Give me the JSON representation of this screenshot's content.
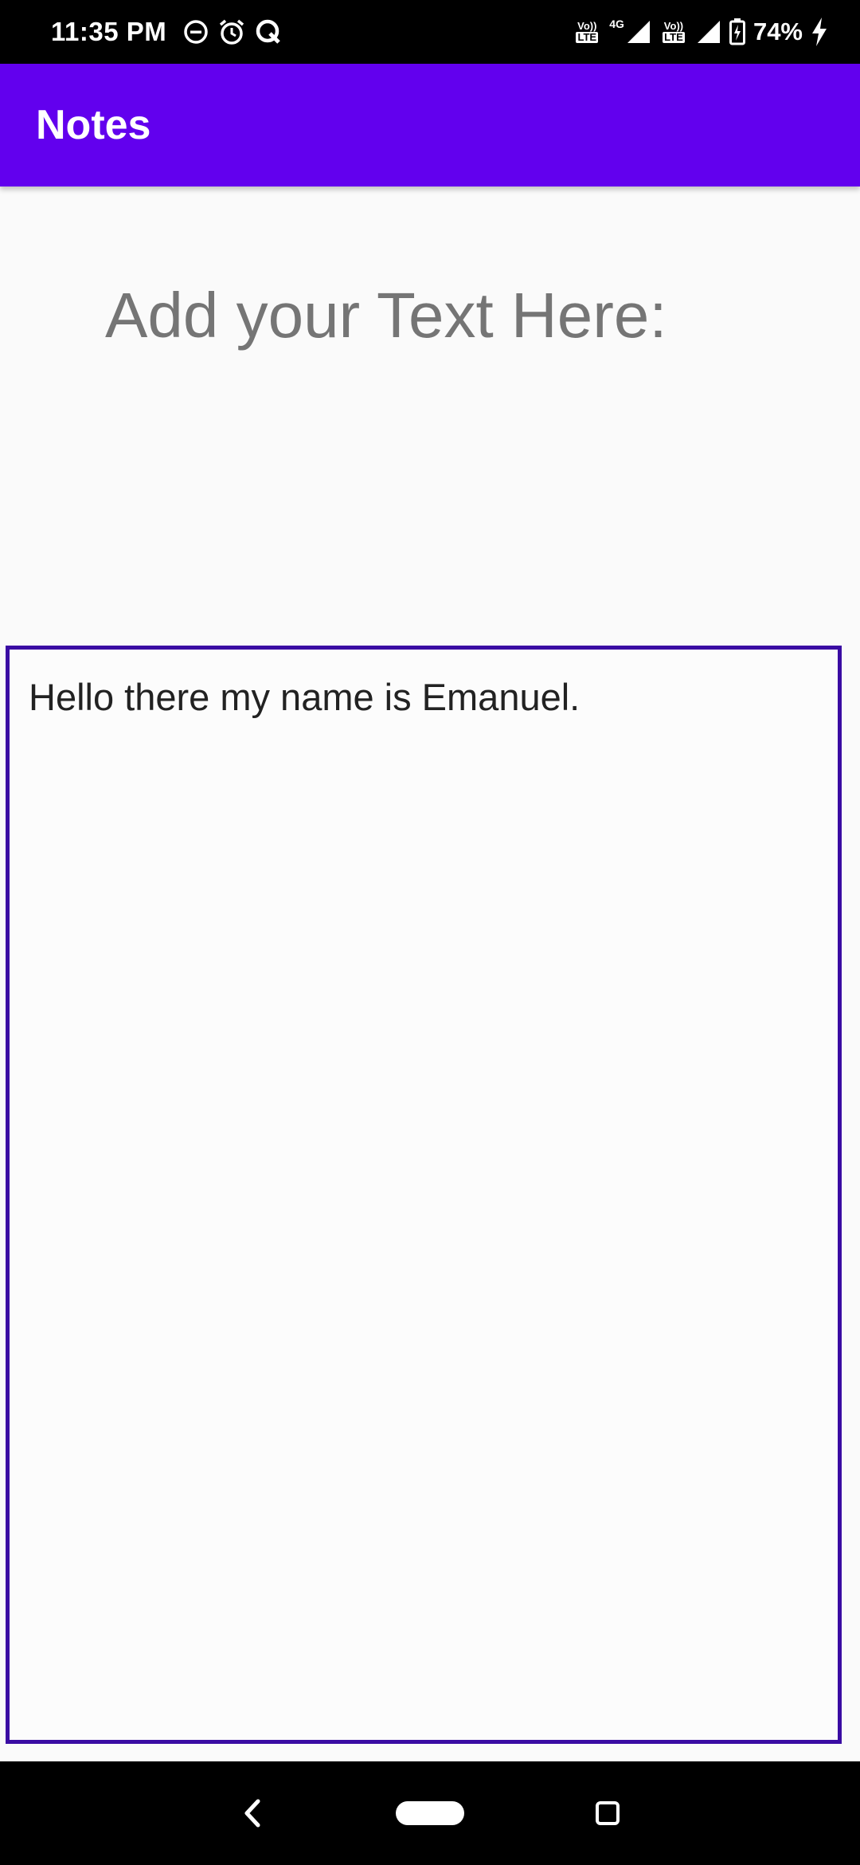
{
  "status_bar": {
    "time": "11:35 PM",
    "left_icons": [
      "do-not-disturb-icon",
      "alarm-icon",
      "q-app-icon"
    ],
    "lte_label": "LTE",
    "volte_label": "Vo))",
    "network_type": "4G",
    "battery_percent": "74%",
    "charging": true
  },
  "app_bar": {
    "title": "Notes",
    "color": "#6200ee"
  },
  "main": {
    "heading": "Add your Text Here:",
    "note_text": "Hello there my name is Emanuel.",
    "editor_border_color": "#3a0ca3"
  },
  "nav_bar": {
    "buttons": [
      "back-icon",
      "home-pill-icon",
      "recents-icon"
    ]
  }
}
